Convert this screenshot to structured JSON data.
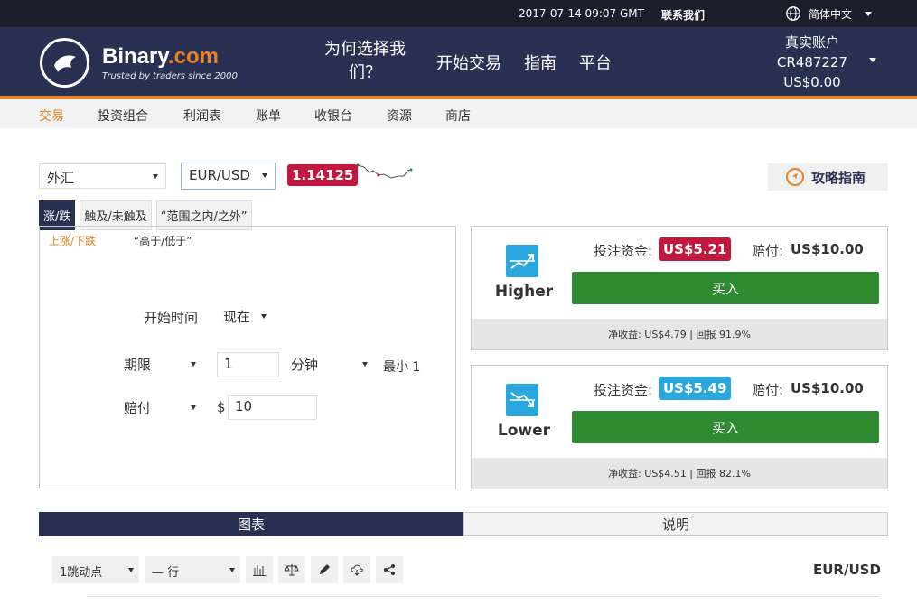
{
  "topbar": {
    "datetime": "2017-07-14 09:07 GMT",
    "contact": "联系我们",
    "language": "简体中文"
  },
  "header": {
    "brand_main": "Binary",
    "brand_suffix": ".com",
    "tagline": "Trusted by traders since 2000",
    "nav": {
      "why": "为何选择我们？",
      "trade": "开始交易",
      "guide": "指南",
      "platform": "平台"
    },
    "account": {
      "type": "真实账户",
      "id": "CR487227",
      "balance": "US$0.00"
    }
  },
  "subnav": [
    "交易",
    "投资组合",
    "利润表",
    "账单",
    "收银台",
    "资源",
    "商店"
  ],
  "market": {
    "category": "外汇",
    "symbol": "EUR/USD",
    "price": "1.14125",
    "guide_button": "攻略指南"
  },
  "tabs": [
    "涨/跌",
    "触及/未触及",
    "“范围之内/之外”"
  ],
  "form": {
    "sub_active": "上涨/下跌",
    "sub_other": "“高于/低于”",
    "start_label": "开始时间",
    "start_value": "现在",
    "duration_type": "期限",
    "duration_value": "1",
    "duration_unit": "分钟",
    "min_label": "最小 1",
    "payout_type": "赔付",
    "currency_symbol": "$",
    "amount": "10"
  },
  "contracts": [
    {
      "name": "Higher",
      "stake_label": "投注资金:",
      "stake": "US$5.21",
      "stake_color": "#c2183d",
      "payout_label": "赔付:",
      "payout": "US$10.00",
      "buy": "买入",
      "footer": "净收益: US$4.79 | 回报 91.9%"
    },
    {
      "name": "Lower",
      "stake_label": "投注资金:",
      "stake": "US$5.49",
      "stake_color": "#2aa7df",
      "payout_label": "赔付:",
      "payout": "US$10.00",
      "buy": "买入",
      "footer": "净收益: US$4.51 | 回报 82.1%"
    }
  ],
  "bottom_tabs": {
    "chart": "图表",
    "explanation": "说明"
  },
  "chart_tools": {
    "interval": "1跳动点",
    "chart_type": "— 行",
    "pair": "EUR/USD"
  }
}
